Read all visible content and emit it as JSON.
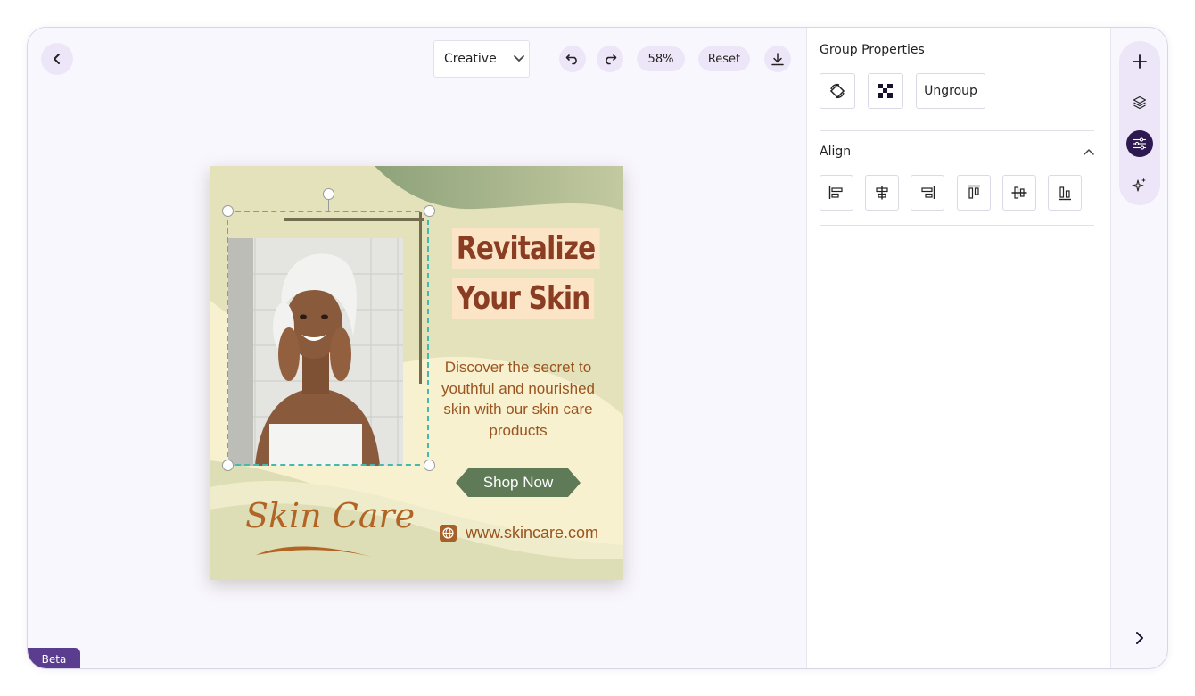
{
  "toolbar": {
    "mode_label": "Creative",
    "zoom_label": "58%",
    "reset_label": "Reset"
  },
  "beta_label": "Beta",
  "design": {
    "headline_line1": "Revitalize",
    "headline_line2": "Your Skin",
    "description": "Discover the secret to youthful and nourished skin with our skin care products",
    "cta_label": "Shop Now",
    "brand": "Skin Care",
    "website": "www.skincare.com"
  },
  "panel": {
    "title": "Group Properties",
    "ungroup_label": "Ungroup",
    "align_title": "Align"
  },
  "colors": {
    "accent": "#2e1850",
    "selection": "#45b8b0",
    "headline": "#8a3d22",
    "cta_bg": "#5e7a57"
  }
}
